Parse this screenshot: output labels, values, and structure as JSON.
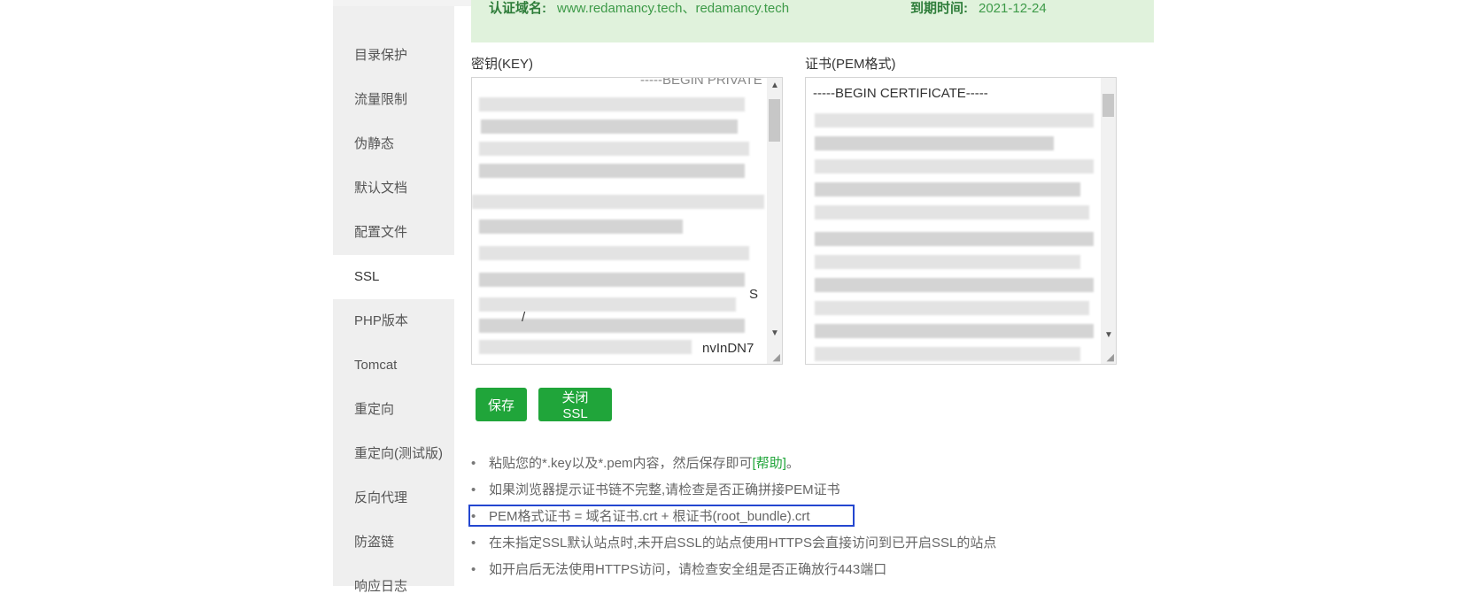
{
  "banner": {
    "domain_label": "认证域名:",
    "domain_value": "www.redamancy.tech、redamancy.tech",
    "expiry_label": "到期时间:",
    "expiry_value": "2021-12-24"
  },
  "sidebar": {
    "items": [
      {
        "label": "目录保护"
      },
      {
        "label": "流量限制"
      },
      {
        "label": "伪静态"
      },
      {
        "label": "默认文档"
      },
      {
        "label": "配置文件"
      },
      {
        "label": "SSL",
        "active": true
      },
      {
        "label": "PHP版本"
      },
      {
        "label": "Tomcat"
      },
      {
        "label": "重定向"
      },
      {
        "label": "重定向(测试版)"
      },
      {
        "label": "反向代理"
      },
      {
        "label": "防盗链"
      },
      {
        "label": "响应日志"
      }
    ]
  },
  "key_field": {
    "label": "密钥(KEY)",
    "visible_fragments": [
      "-----BEGIN PRIVATE KEY-----",
      "S",
      "/",
      "nvInDN7"
    ]
  },
  "cert_field": {
    "label": "证书(PEM格式)",
    "visible_fragments": [
      "-----BEGIN CERTIFICATE-----"
    ]
  },
  "actions": {
    "save_label": "保存",
    "close_ssl_label": "关闭SSL"
  },
  "tips": {
    "tip1_text": "粘贴您的*.key以及*.pem内容，然后保存即可",
    "tip1_link": "[帮助]",
    "tip1_suffix": "。",
    "tip2": "如果浏览器提示证书链不完整,请检查是否正确拼接PEM证书",
    "tip3": "PEM格式证书 = 域名证书.crt + 根证书(root_bundle).crt",
    "tip4": "在未指定SSL默认站点时,未开启SSL的站点使用HTTPS会直接访问到已开启SSL的站点",
    "tip5": "如开启后无法使用HTTPS访问，请检查安全组是否正确放行443端口"
  },
  "colors": {
    "accent_green": "#20a53a",
    "banner_bg": "#e0f2dc",
    "highlight_border": "#2447d0",
    "sidebar_bg": "#efefef"
  }
}
